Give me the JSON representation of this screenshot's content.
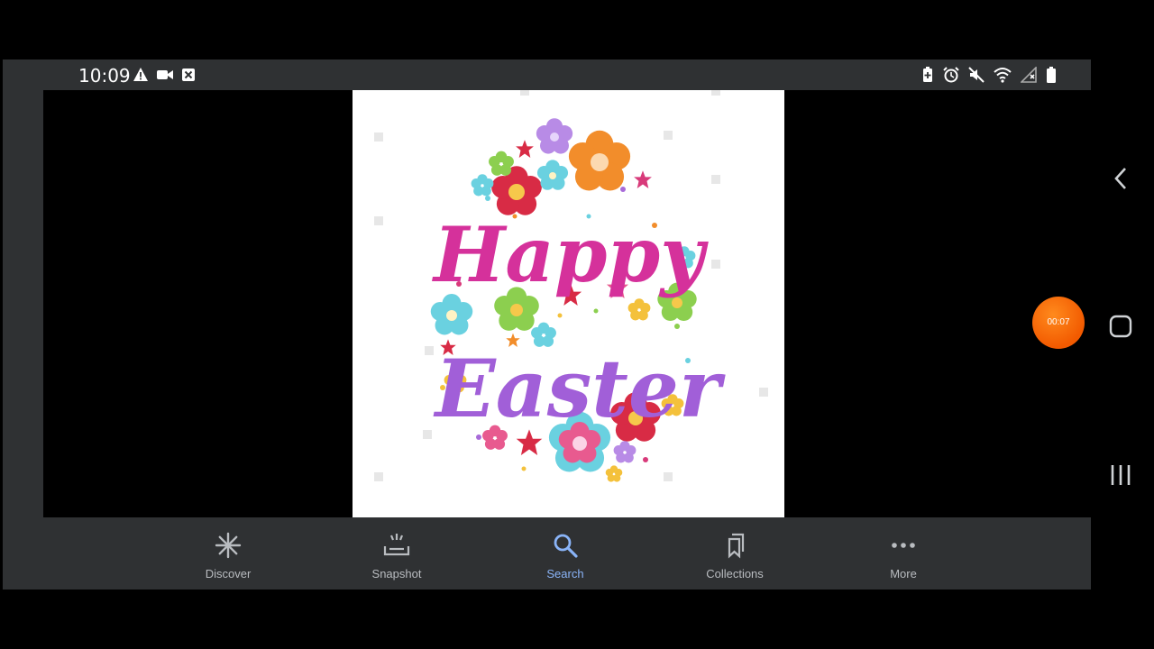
{
  "status_bar": {
    "time": "10:09",
    "left_icons": [
      "alert-icon",
      "video-camera-icon",
      "close-box-icon"
    ],
    "right_icons": [
      "battery-saver-icon",
      "alarm-icon",
      "mute-icon",
      "wifi-icon",
      "signal-icon",
      "battery-icon"
    ]
  },
  "image": {
    "line1": "Happy",
    "line2": "Easter"
  },
  "bottom_nav": {
    "items": [
      {
        "label": "Discover",
        "icon": "asterisk-icon"
      },
      {
        "label": "Snapshot",
        "icon": "snapshot-icon"
      },
      {
        "label": "Search",
        "icon": "search-icon"
      },
      {
        "label": "Collections",
        "icon": "bookmarks-icon"
      },
      {
        "label": "More",
        "icon": "more-dots-icon"
      }
    ],
    "active": "Search"
  },
  "recorder": {
    "timer": "00:07"
  },
  "system_nav": [
    "back-icon",
    "home-icon",
    "recents-icon"
  ],
  "colors": {
    "active": "#8ab4f8",
    "inactive": "#b9bcc0",
    "recorder": "#f25a00"
  }
}
